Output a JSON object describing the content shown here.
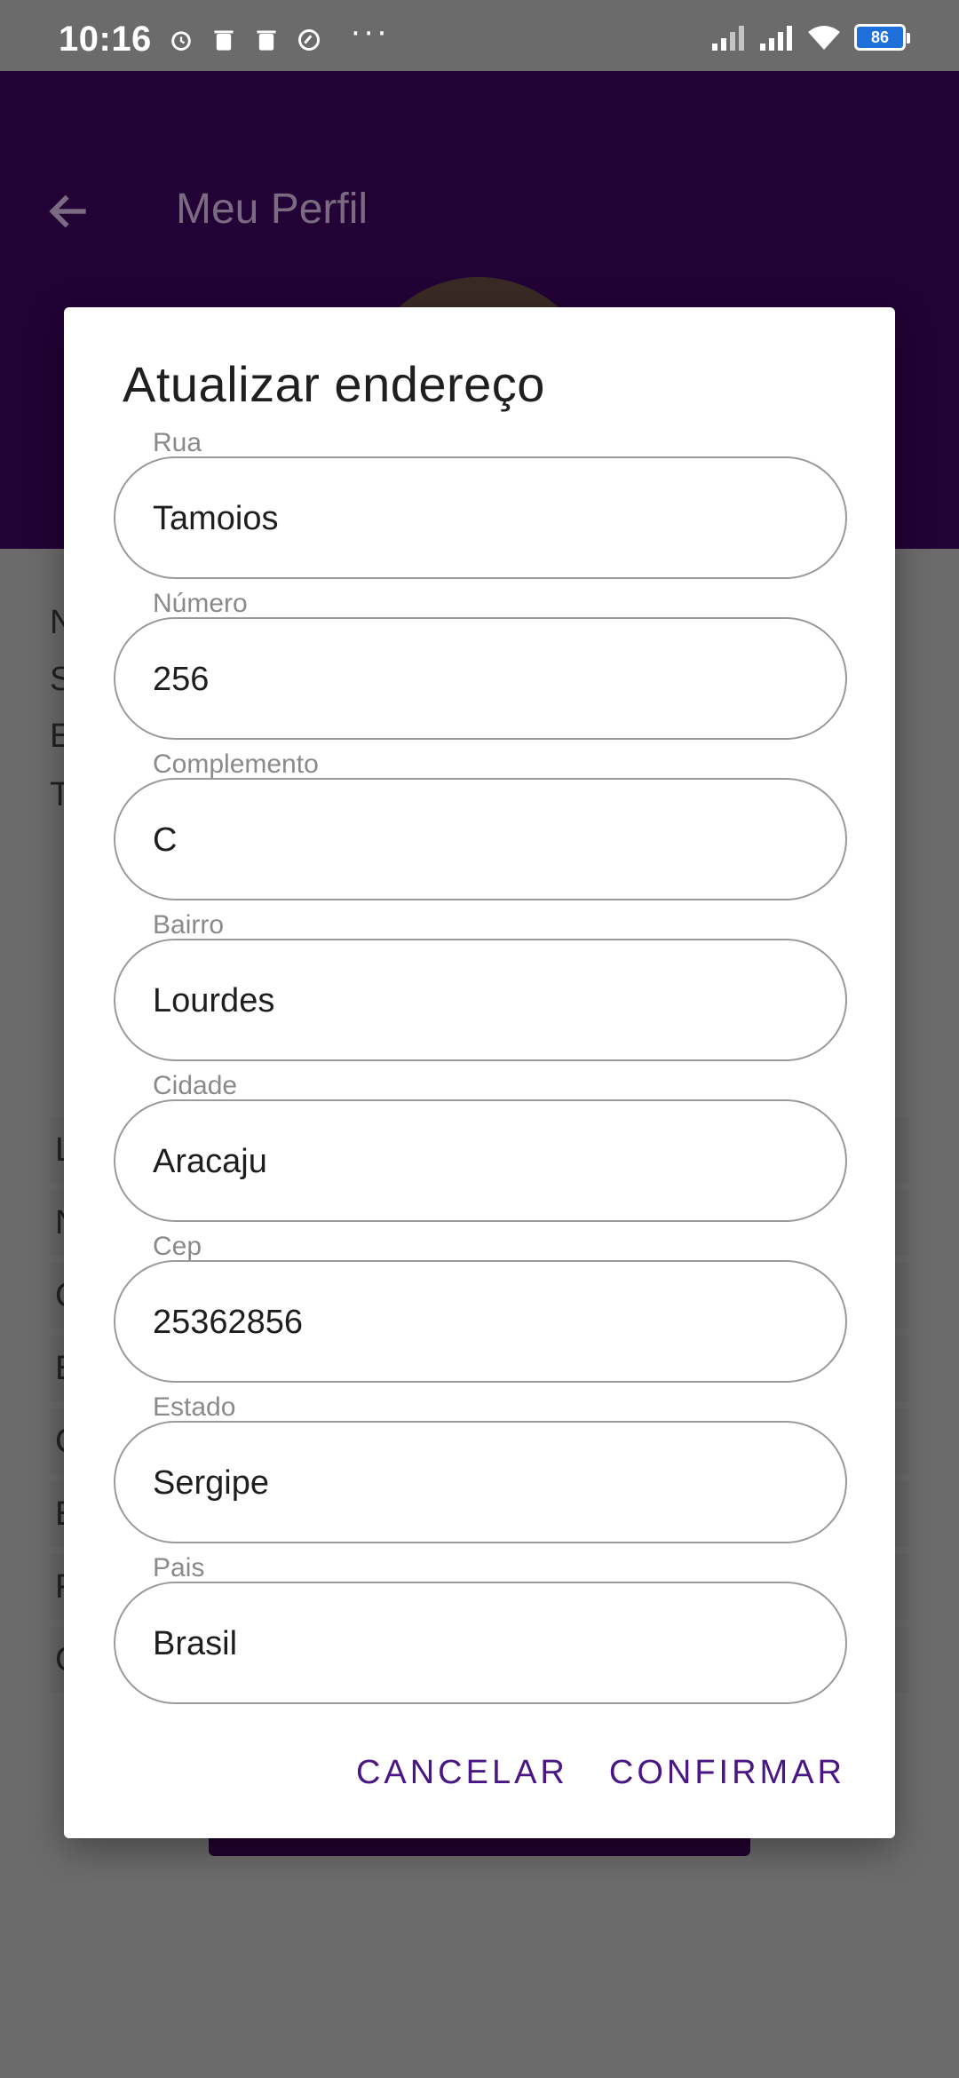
{
  "status_bar": {
    "time": "10:16",
    "more": "···",
    "battery": "86"
  },
  "app_bar": {
    "title": "Meu Perfil"
  },
  "background_initials": [
    "N",
    "S",
    "E",
    "T"
  ],
  "background_rows": [
    "L",
    "N",
    "C",
    "E",
    "C",
    "E",
    "F",
    "C"
  ],
  "dialog": {
    "title": "Atualizar endereço",
    "fields": [
      {
        "label": "Rua",
        "value": "Tamoios"
      },
      {
        "label": "Número",
        "value": "256"
      },
      {
        "label": "Complemento",
        "value": "C"
      },
      {
        "label": "Bairro",
        "value": "Lourdes"
      },
      {
        "label": "Cidade",
        "value": "Aracaju"
      },
      {
        "label": "Cep",
        "value": "25362856"
      },
      {
        "label": "Estado",
        "value": "Sergipe"
      },
      {
        "label": "Pais",
        "value": "Brasil"
      }
    ],
    "cancel_label": "CANCELAR",
    "confirm_label": "CONFIRMAR"
  },
  "colors": {
    "accent": "#4a1686",
    "app_bar": "#230235",
    "scrim": "#6b6b6b"
  }
}
